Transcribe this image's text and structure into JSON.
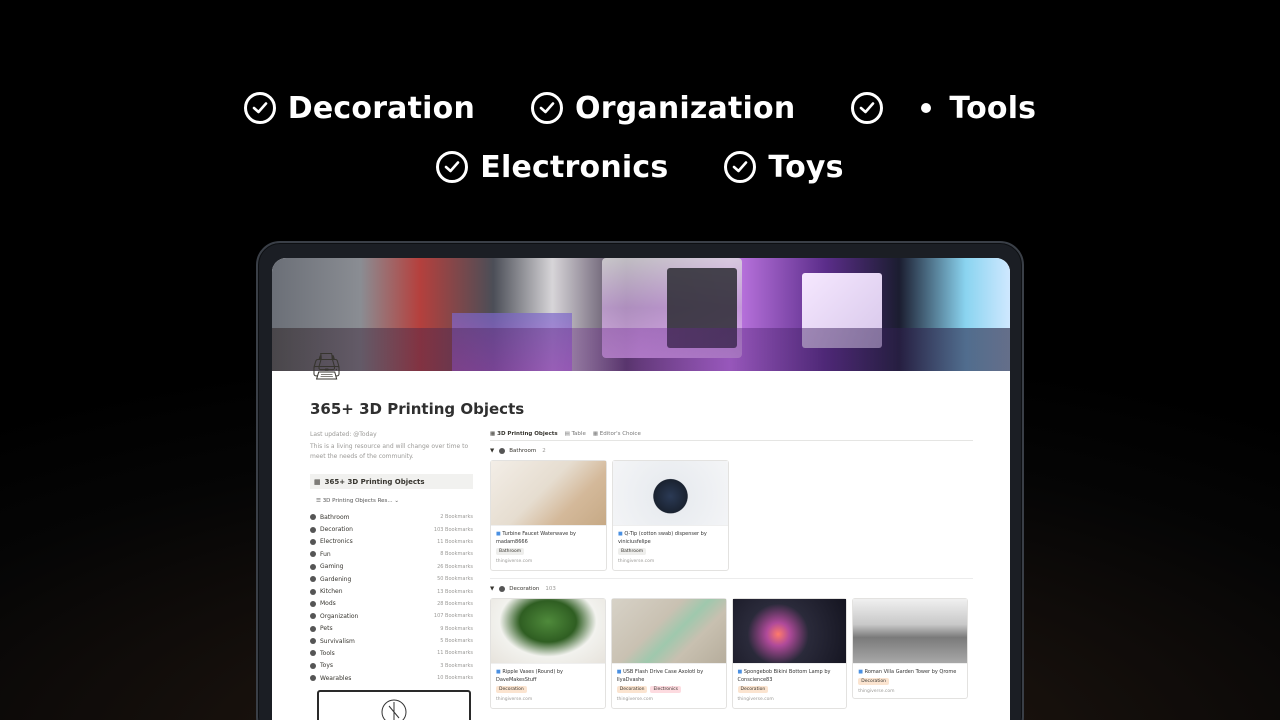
{
  "features": {
    "row1": [
      {
        "label": "Decoration"
      },
      {
        "label": "Organization"
      },
      {
        "label": "Tools"
      }
    ],
    "row2": [
      {
        "label": "Electronics"
      },
      {
        "label": "Toys"
      }
    ]
  },
  "page": {
    "title": "365+ 3D Printing Objects",
    "last_updated": "Last updated: @Today",
    "description": "This is a living resource and will change over time to meet the needs of the community.",
    "db_link": "365+ 3D Printing Objects",
    "sub_link": "3D Printing Objects Res..."
  },
  "categories": [
    {
      "name": "Bathroom",
      "count": "2 Bookmarks"
    },
    {
      "name": "Decoration",
      "count": "103 Bookmarks"
    },
    {
      "name": "Electronics",
      "count": "11 Bookmarks"
    },
    {
      "name": "Fun",
      "count": "8 Bookmarks"
    },
    {
      "name": "Gaming",
      "count": "26 Bookmarks"
    },
    {
      "name": "Gardening",
      "count": "50 Bookmarks"
    },
    {
      "name": "Kitchen",
      "count": "13 Bookmarks"
    },
    {
      "name": "Mods",
      "count": "28 Bookmarks"
    },
    {
      "name": "Organization",
      "count": "107 Bookmarks"
    },
    {
      "name": "Pets",
      "count": "9 Bookmarks"
    },
    {
      "name": "Survivalism",
      "count": "5 Bookmarks"
    },
    {
      "name": "Tools",
      "count": "11 Bookmarks"
    },
    {
      "name": "Toys",
      "count": "3 Bookmarks"
    },
    {
      "name": "Wearables",
      "count": "10 Bookmarks"
    }
  ],
  "tabs": [
    "3D Printing Objects",
    "Table",
    "Editor's Choice"
  ],
  "groups": [
    {
      "name": "Bathroom",
      "count": "2",
      "cards": [
        {
          "title": "Turbine Faucet Waterwave by madam8666",
          "tags": [
            "Bathroom"
          ],
          "site": "thingiverse.com"
        },
        {
          "title": "Q-Tip (cotton swab) dispenser by viniciusfelipe",
          "tags": [
            "Bathroom"
          ],
          "site": "thingiverse.com"
        }
      ]
    },
    {
      "name": "Decoration",
      "count": "103",
      "cards": [
        {
          "title": "Ripple Vases (Round) by DaveMakesStuff",
          "tags": [
            "Decoration"
          ],
          "site": "thingiverse.com"
        },
        {
          "title": "USB Flash Drive Case Axolotl by IlyaDvashe",
          "tags": [
            "Decoration",
            "Electronics"
          ],
          "site": "thingiverse.com"
        },
        {
          "title": "Spongebob Bikini Bottom Lamp by Conscience83",
          "tags": [
            "Decoration"
          ],
          "site": "thingiverse.com"
        },
        {
          "title": "Roman Villa Garden Tower by Qrome",
          "tags": [
            "Decoration"
          ],
          "site": "thingiverse.com"
        }
      ]
    }
  ],
  "colors": {
    "tag_bathroom": "#eeeeec",
    "tag_decoration": "#fbe4d0",
    "tag_electronics": "#fddbe0"
  }
}
